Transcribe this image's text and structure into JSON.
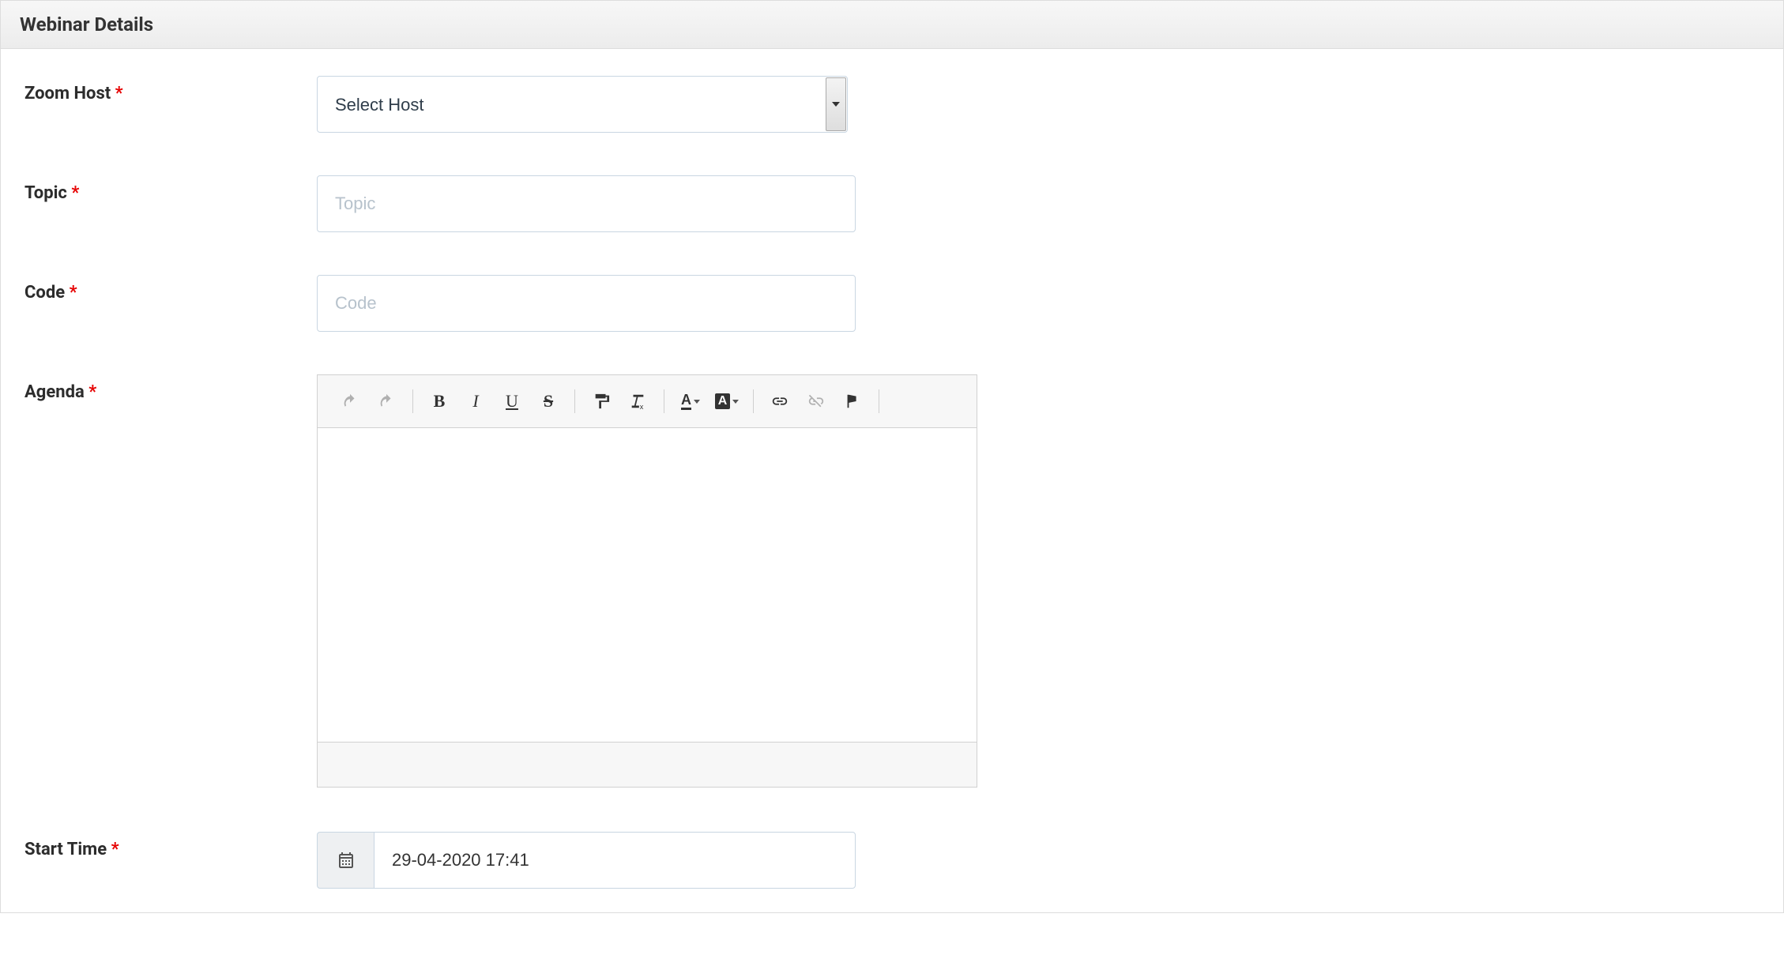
{
  "panel": {
    "title": "Webinar Details"
  },
  "form": {
    "zoom_host": {
      "label": "Zoom Host",
      "selected": "Select Host"
    },
    "topic": {
      "label": "Topic",
      "placeholder": "Topic",
      "value": ""
    },
    "code": {
      "label": "Code",
      "placeholder": "Code",
      "value": ""
    },
    "agenda": {
      "label": "Agenda",
      "value": ""
    },
    "start_time": {
      "label": "Start Time",
      "value": "29-04-2020 17:41"
    }
  },
  "editor_toolbar": {
    "undo": "undo",
    "redo": "redo",
    "bold": "B",
    "italic": "I",
    "underline": "U",
    "strike": "S",
    "paint": "copy-formatting",
    "clear": "remove-format",
    "textcolor": "A",
    "bgcolor": "A",
    "link": "link",
    "unlink": "unlink",
    "anchor": "anchor"
  }
}
